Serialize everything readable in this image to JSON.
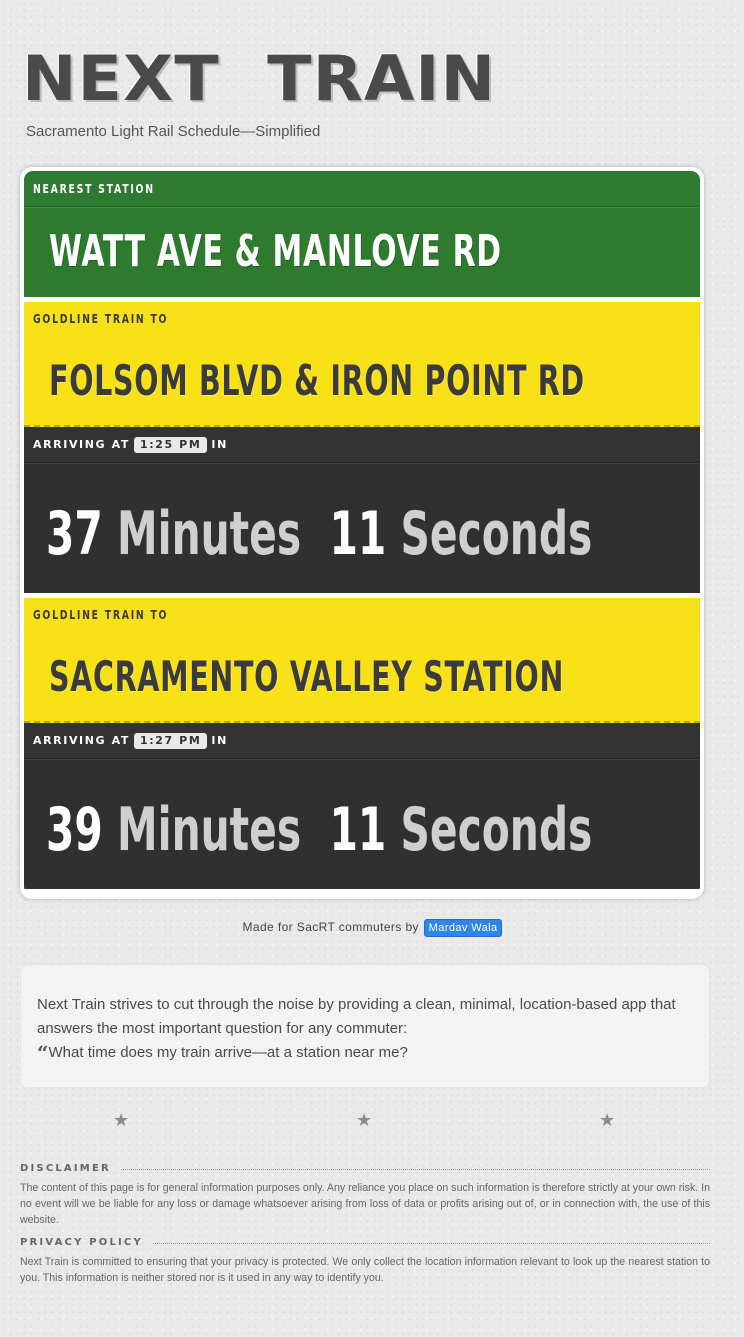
{
  "header": {
    "title": "NEXT  TRAIN",
    "subtitle": "Sacramento Light Rail Schedule—Simplified"
  },
  "station": {
    "label": "NEAREST STATION",
    "name": "WATT AVE & MANLOVE RD"
  },
  "trains": [
    {
      "label": "GOLDLINE TRAIN TO",
      "destination": "FOLSOM BLVD & IRON POINT RD",
      "arriving_label": "ARRIVING AT",
      "time": "1:25 PM",
      "in_label": "IN",
      "minutes": "37",
      "minutes_unit": "Minutes",
      "seconds": "11",
      "seconds_unit": "Seconds"
    },
    {
      "label": "GOLDLINE TRAIN TO",
      "destination": "SACRAMENTO VALLEY STATION",
      "arriving_label": "ARRIVING AT",
      "time": "1:27 PM",
      "in_label": "IN",
      "minutes": "39",
      "minutes_unit": "Minutes",
      "seconds": "11",
      "seconds_unit": "Seconds"
    }
  ],
  "credit": {
    "text": "Made for SacRT commuters by",
    "author": "Mardav Wala"
  },
  "about": {
    "text": "Next Train strives to cut through the noise by providing a clean, minimal, location-based app that answers the most important question for any commuter:",
    "quote_mark": "“",
    "question": "What time does my train arrive—at a station near me?"
  },
  "stars": [
    "★",
    "★",
    "★"
  ],
  "legal": {
    "disclaimer_title": "DISCLAIMER",
    "disclaimer_text": "The content of this page is for general information purposes only. Any reliance you place on such information is therefore strictly at your own risk. In no event will we be liable for any loss or damage whatsoever arising from loss of data or profits arising out of, or in connection with, the use of this website.",
    "privacy_title": "PRIVACY POLICY",
    "privacy_text": "Next Train is committed to ensuring that your privacy is protected. We only collect the location information relevant to look up the nearest station to you. This information is neither stored nor is it used in any way to identify you."
  },
  "colors": {
    "green": "#2e7b2f",
    "yellow": "#f8e116",
    "dark": "#303030",
    "link": "#2f86e8"
  }
}
